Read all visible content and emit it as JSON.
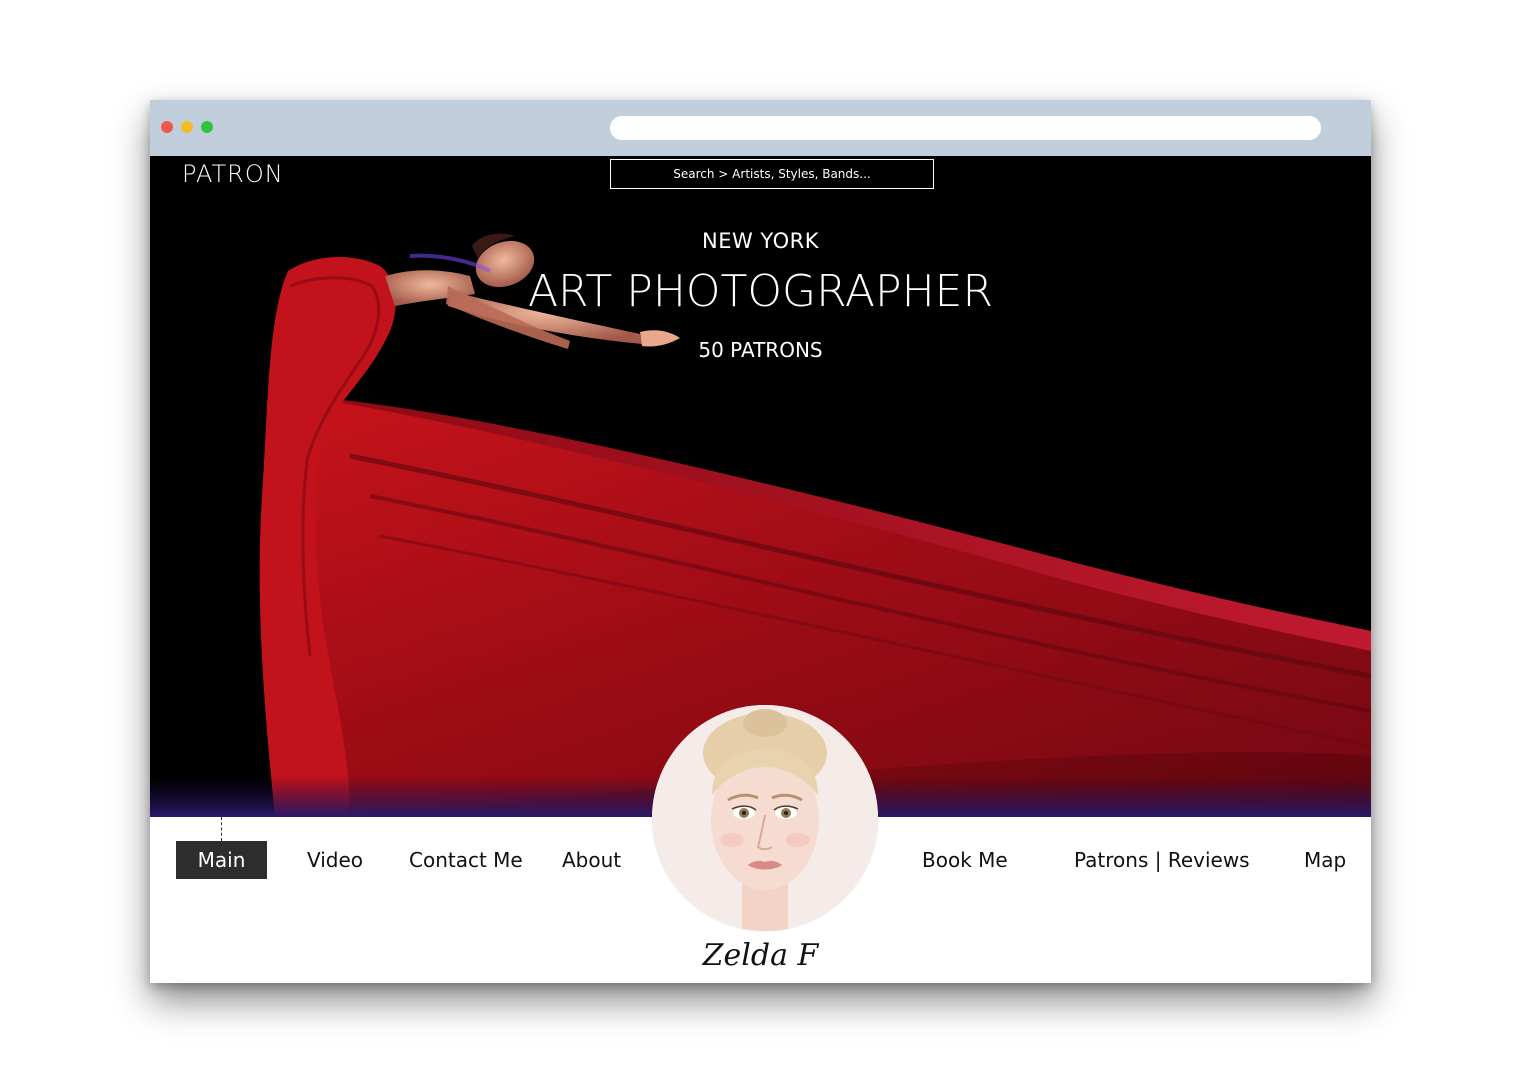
{
  "site": {
    "brand": "PATRON",
    "search_placeholder": "Search > Artists, Styles, Bands..."
  },
  "hero": {
    "city": "NEW YORK",
    "role": "ART PHOTOGRAPHER",
    "patrons": "50 PATRONS"
  },
  "nav": {
    "items": [
      {
        "label": "Main",
        "active": true
      },
      {
        "label": "Video"
      },
      {
        "label": "Contact Me"
      },
      {
        "label": "About"
      },
      {
        "label": "Book Me"
      },
      {
        "label": "Patrons | Reviews"
      },
      {
        "label": "Map"
      }
    ]
  },
  "profile": {
    "name": "Zelda F"
  },
  "colors": {
    "chrome": "#c0cfdb",
    "hero_bg": "#000000",
    "dress_red": "#b5101a",
    "nav_active_bg": "#2d2d2d"
  }
}
